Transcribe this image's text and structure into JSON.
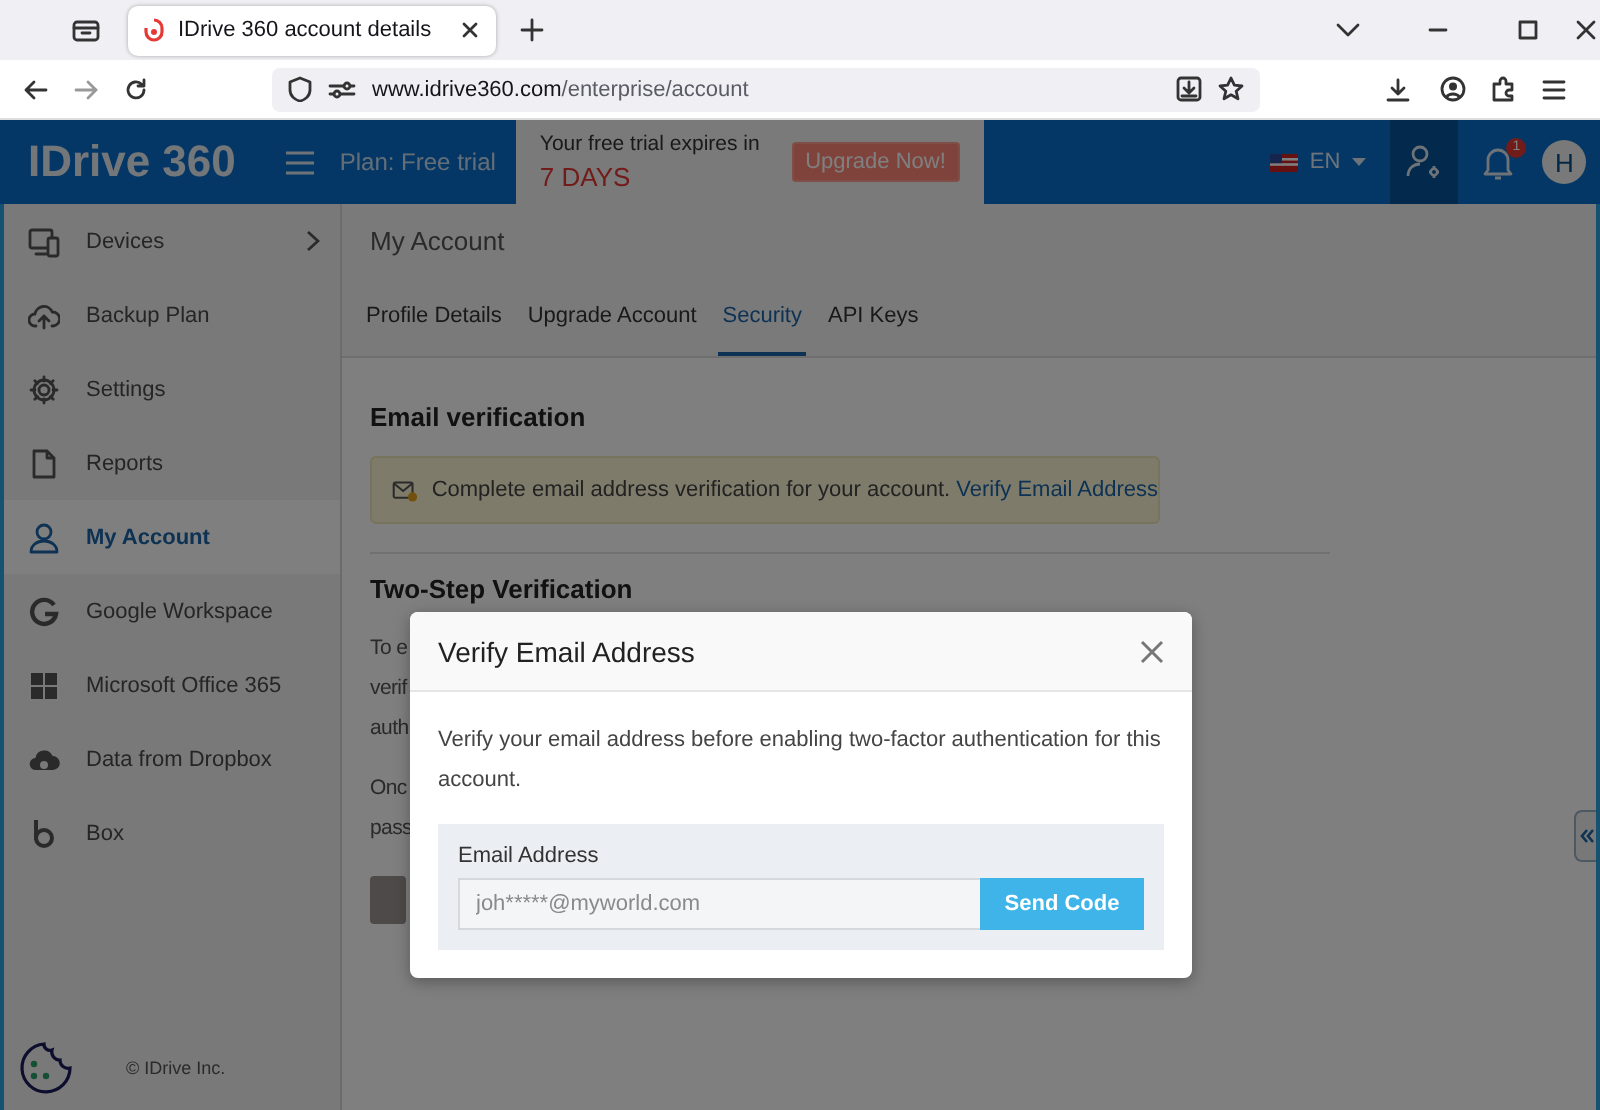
{
  "browser": {
    "tab_title": "IDrive 360 account details",
    "url_host": "www.idrive360.com",
    "url_path": "/enterprise/account"
  },
  "header": {
    "logo": "IDrive",
    "logo_suffix": "360",
    "plan": "Plan: Free trial",
    "trial_text": "Your free trial expires in",
    "trial_days": "7 DAYS",
    "upgrade_button": "Upgrade Now!",
    "language": "EN",
    "notification_count": "1",
    "avatar": "H"
  },
  "sidebar": {
    "items": [
      {
        "label": "Devices",
        "selected": false,
        "expandable": true
      },
      {
        "label": "Backup Plan",
        "selected": false,
        "expandable": false
      },
      {
        "label": "Settings",
        "selected": false,
        "expandable": false
      },
      {
        "label": "Reports",
        "selected": false,
        "expandable": false
      },
      {
        "label": "My Account",
        "selected": true,
        "expandable": false
      },
      {
        "label": "Google Workspace",
        "selected": false,
        "expandable": false
      },
      {
        "label": "Microsoft Office 365",
        "selected": false,
        "expandable": false
      },
      {
        "label": "Data from Dropbox",
        "selected": false,
        "expandable": false
      },
      {
        "label": "Box",
        "selected": false,
        "expandable": false
      }
    ],
    "footer": "© IDrive Inc."
  },
  "page": {
    "title": "My Account",
    "tabs": [
      {
        "label": "Profile Details",
        "selected": false
      },
      {
        "label": "Upgrade Account",
        "selected": false
      },
      {
        "label": "Security",
        "selected": true
      },
      {
        "label": "API Keys",
        "selected": false
      }
    ],
    "email_section": {
      "heading": "Email verification",
      "alert_text": "Complete email address verification for your account.",
      "alert_link": "Verify Email Address"
    },
    "two_step_section": {
      "heading": "Two-Step Verification",
      "lines": [
        "To e",
        "verif",
        "auth"
      ],
      "lines_2": [
        "Onc",
        "pass"
      ]
    }
  },
  "dialog": {
    "title": "Verify Email Address",
    "message": "Verify your email address before enabling two-factor authentication for this account.",
    "field_label": "Email Address",
    "field_value": "joh*****@myworld.com",
    "button": "Send Code"
  }
}
